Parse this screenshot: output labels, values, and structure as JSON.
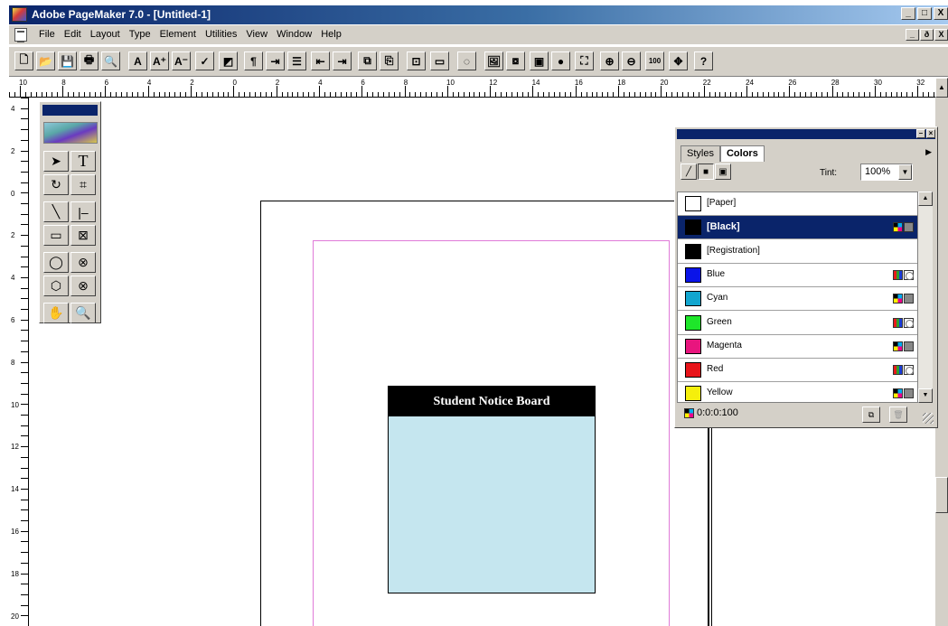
{
  "window": {
    "title": "Adobe PageMaker 7.0 - [Untitled-1]",
    "controls": [
      "_",
      "□",
      "X"
    ],
    "doc_controls": [
      "_",
      "ð",
      "X"
    ]
  },
  "menubar": {
    "items": [
      "File",
      "Edit",
      "Layout",
      "Type",
      "Element",
      "Utilities",
      "View",
      "Window",
      "Help"
    ]
  },
  "toolbar": {
    "buttons": [
      {
        "icon": "new-document-icon",
        "glyph": "🗋"
      },
      {
        "icon": "open-icon",
        "glyph": "📂"
      },
      {
        "icon": "save-icon",
        "glyph": "💾"
      },
      {
        "icon": "print-icon",
        "glyph": "🖶"
      },
      {
        "icon": "find-icon",
        "glyph": "🔍"
      },
      {
        "icon": "character-format-icon",
        "glyph": "A"
      },
      {
        "icon": "increase-font-icon",
        "glyph": "A⁺"
      },
      {
        "icon": "decrease-font-icon",
        "glyph": "A⁻"
      },
      {
        "icon": "spell-check-icon",
        "glyph": "✓"
      },
      {
        "icon": "fill-stroke-icon",
        "glyph": "◩"
      },
      {
        "icon": "paragraph-icon",
        "glyph": "¶"
      },
      {
        "icon": "indents-tabs-icon",
        "glyph": "⇥"
      },
      {
        "icon": "bullets-icon",
        "glyph": "☰"
      },
      {
        "icon": "decrease-indent-icon",
        "glyph": "⇤"
      },
      {
        "icon": "increase-indent-icon",
        "glyph": "⇥"
      },
      {
        "icon": "copy-icon",
        "glyph": "⧉"
      },
      {
        "icon": "paste-icon",
        "glyph": "⎘"
      },
      {
        "icon": "frame-icon",
        "glyph": "⊡"
      },
      {
        "icon": "export-icon",
        "glyph": "▭"
      },
      {
        "icon": "link-icon",
        "glyph": "◌"
      },
      {
        "icon": "place-image-icon",
        "glyph": "🖼"
      },
      {
        "icon": "image-frame-icon",
        "glyph": "⧇"
      },
      {
        "icon": "photo-icon",
        "glyph": "▣"
      },
      {
        "icon": "globe-icon",
        "glyph": "●"
      },
      {
        "icon": "pdf-icon",
        "glyph": "⛶"
      },
      {
        "icon": "zoom-in-icon",
        "glyph": "⊕"
      },
      {
        "icon": "zoom-out-icon",
        "glyph": "⊖"
      },
      {
        "icon": "actual-size-icon",
        "glyph": "100"
      },
      {
        "icon": "fit-window-icon",
        "glyph": "✥"
      },
      {
        "icon": "help-icon",
        "glyph": "?"
      }
    ]
  },
  "rulers": {
    "horizontal_labels": [
      "10",
      "8",
      "6",
      "4",
      "2",
      "0",
      "2",
      "4",
      "6",
      "8",
      "10",
      "12",
      "14",
      "16",
      "18",
      "20",
      "22",
      "24",
      "26",
      "28",
      "30",
      "32"
    ],
    "vertical_labels": [
      "4",
      "2",
      "0",
      "2",
      "4",
      "6",
      "8",
      "10",
      "12",
      "14",
      "16",
      "18",
      "20"
    ]
  },
  "toolbox": {
    "tools": [
      {
        "name": "pointer-tool",
        "glyph": "➤"
      },
      {
        "name": "text-tool",
        "glyph": "T"
      },
      {
        "name": "rotate-tool",
        "glyph": "↻"
      },
      {
        "name": "crop-tool",
        "glyph": "⌗"
      },
      {
        "name": "line-tool",
        "glyph": "╲"
      },
      {
        "name": "constrained-line-tool",
        "glyph": "|–"
      },
      {
        "name": "rectangle-tool",
        "glyph": "▭"
      },
      {
        "name": "rectangle-frame-tool",
        "glyph": "⊠"
      },
      {
        "name": "ellipse-tool",
        "glyph": "◯"
      },
      {
        "name": "ellipse-frame-tool",
        "glyph": "⊗"
      },
      {
        "name": "polygon-tool",
        "glyph": "⬡"
      },
      {
        "name": "polygon-frame-tool",
        "glyph": "⊗"
      },
      {
        "name": "hand-tool",
        "glyph": "✋"
      },
      {
        "name": "zoom-tool",
        "glyph": "🔍"
      }
    ]
  },
  "document": {
    "notice_title": "Student Notice Board",
    "notice_fill": "#c5e6ef",
    "margin_guide_color": "#e07ad8"
  },
  "colors_palette": {
    "tabs": [
      "Styles",
      "Colors"
    ],
    "active_tab": "Colors",
    "tint_label": "Tint:",
    "tint_value": "100%",
    "swatches": [
      {
        "name": "[Paper]",
        "color": "#ffffff",
        "icons": []
      },
      {
        "name": "[Black]",
        "color": "#000000",
        "icons": [
          "cmyk",
          "process"
        ],
        "selected": true
      },
      {
        "name": "[Registration]",
        "color": "#000000",
        "icons": []
      },
      {
        "name": "Blue",
        "color": "#0a14e8",
        "icons": [
          "rgb",
          "spot"
        ]
      },
      {
        "name": "Cyan",
        "color": "#12a6cf",
        "icons": [
          "cmyk",
          "process"
        ]
      },
      {
        "name": "Green",
        "color": "#1ee62a",
        "icons": [
          "rgb",
          "spot"
        ]
      },
      {
        "name": "Magenta",
        "color": "#e8157e",
        "icons": [
          "cmyk",
          "process"
        ]
      },
      {
        "name": "Red",
        "color": "#e8141a",
        "icons": [
          "rgb",
          "spot"
        ]
      },
      {
        "name": "Yellow",
        "color": "#f5ef0c",
        "icons": [
          "cmyk",
          "process"
        ]
      }
    ],
    "status": "0:0:0:100"
  }
}
